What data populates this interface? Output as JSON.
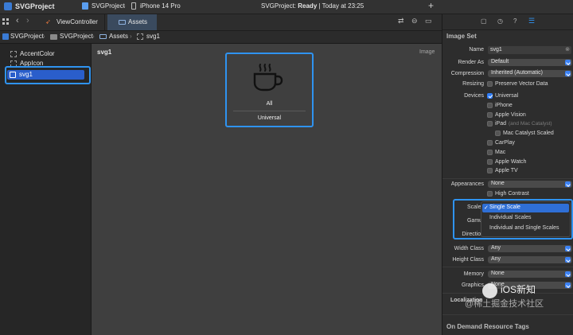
{
  "toolbar": {
    "project_name": "SVGProject",
    "scheme": "SVGProject",
    "device": "iPhone 14 Pro",
    "status_project": "SVGProject:",
    "status_state": "Ready",
    "status_time": "| Today at 23:25",
    "add_label": "+"
  },
  "tabs": [
    {
      "label": "ViewController"
    },
    {
      "label": "Assets"
    }
  ],
  "breadcrumb": [
    "SVGProject",
    "SVGProject",
    "Assets",
    "svg1"
  ],
  "navigator": {
    "items": [
      {
        "label": "AccentColor"
      },
      {
        "label": "AppIcon"
      },
      {
        "label": "svg1"
      }
    ]
  },
  "canvas": {
    "set_name": "svg1",
    "kind_label": "Image",
    "slot_label": "All",
    "slot_caption": "Universal"
  },
  "inspector": {
    "section_title": "Image Set",
    "name_label": "Name",
    "name_value": "svg1",
    "render_as_label": "Render As",
    "render_as_value": "Default",
    "compression_label": "Compression",
    "compression_value": "Inherited (Automatic)",
    "resizing_label": "Resizing",
    "resizing_option": "Preserve Vector Data",
    "devices_label": "Devices",
    "devices": [
      {
        "label": "Universal",
        "checked": true
      },
      {
        "label": "iPhone",
        "checked": false
      },
      {
        "label": "Apple Vision",
        "checked": false
      },
      {
        "label": "iPad",
        "checked": false,
        "note": "(and Mac Catalyst)"
      },
      {
        "label": "Mac Catalyst Scaled",
        "checked": false
      },
      {
        "label": "CarPlay",
        "checked": false
      },
      {
        "label": "Mac",
        "checked": false
      },
      {
        "label": "Apple Watch",
        "checked": false
      },
      {
        "label": "Apple TV",
        "checked": false
      }
    ],
    "appearances_label": "Appearances",
    "appearances_value": "None",
    "high_contrast": "High Contrast",
    "scales_label": "Scales",
    "gamut_label": "Gamut",
    "direction_label": "Direction",
    "scales_menu": [
      "Single Scale",
      "Individual Scales",
      "Individual and Single Scales"
    ],
    "scales_selected": "Single Scale",
    "width_class_label": "Width Class",
    "width_class_value": "Any",
    "height_class_label": "Height Class",
    "height_class_value": "Any",
    "memory_label": "Memory",
    "memory_value": "None",
    "graphics_label": "Graphics",
    "graphics_value": "None",
    "localization_label": "Localization",
    "odr_label": "On Demand Resource Tags"
  },
  "watermark": {
    "handle": "@稀土掘金技术社区",
    "brand": "iOS新知"
  },
  "colors": {
    "accent": "#2f93f0",
    "selection": "#2a5ecb"
  }
}
